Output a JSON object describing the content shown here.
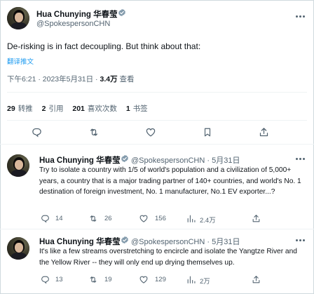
{
  "main_tweet": {
    "display_name": "Hua Chunying 华春莹",
    "handle": "@SpokespersonCHN",
    "text": "De-risking is in fact decoupling. But think about that:",
    "translate_label": "翻译推文",
    "timestamp": "下午6:21 · 2023年5月31日 · ",
    "views_count": "3.4万",
    "views_label": "查看",
    "retweets_count": "29",
    "retweets_label": "转推",
    "quotes_count": "2",
    "quotes_label": "引用",
    "likes_count": "201",
    "likes_label": "喜欢次数",
    "bookmarks_count": "1",
    "bookmarks_label": "书签"
  },
  "replies": [
    {
      "display_name": "Hua Chunying 华春莹",
      "handle": "@SpokespersonCHN · 5月31日",
      "text": "Try to isolate a country with 1/5 of world's population and a civilization of 5,000+ years, a country that is a major trading partner of 140+ countries, and world's No. 1 destination of foreign investment, No. 1 manufacturer, No.1 EV exporter...?",
      "reply_count": "14",
      "retweet_count": "26",
      "like_count": "156",
      "view_count": "2.4万"
    },
    {
      "display_name": "Hua Chunying 华春莹",
      "handle": "@SpokespersonCHN · 5月31日",
      "text": "It's like a few streams overstretching to encircle and isolate the Yangtze River and the Yellow River -- they will only end up drying themselves up.",
      "reply_count": "13",
      "retweet_count": "19",
      "like_count": "129",
      "view_count": "2万"
    }
  ],
  "colors": {
    "accent": "#1d9bf0",
    "secondary_text": "#536471",
    "primary_text": "#0f1419"
  }
}
